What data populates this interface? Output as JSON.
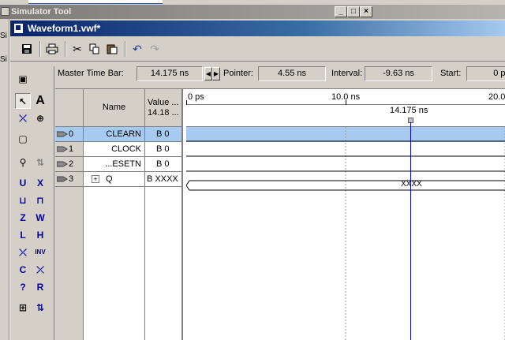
{
  "outer_window": {
    "title": "Simulator Tool",
    "controls": {
      "minimize": "_",
      "maximize": "□",
      "close": "×"
    },
    "side_text": [
      "Si",
      "Si"
    ]
  },
  "inner_window": {
    "title": "Waveform1.vwf*"
  },
  "toolbar": {
    "save_icon": "save-icon",
    "print_icon": "print-icon",
    "cut_icon": "scissors-icon",
    "copy_icon": "copy-icon",
    "paste_icon": "paste-icon",
    "undo_icon": "undo-icon",
    "redo_icon": "redo-icon"
  },
  "timebar": {
    "master_label": "Master Time Bar:",
    "master_value": "14.175 ns",
    "pointer_label": "Pointer:",
    "pointer_value": "4.55 ns",
    "interval_label": "Interval:",
    "interval_value": "-9.63 ns",
    "start_label": "Start:",
    "start_value": "0 ps"
  },
  "grid": {
    "name_header": "Name",
    "value_header_line1": "Value ...",
    "value_header_line2": "14.18 ...",
    "ruler": {
      "tick0": "0 ps",
      "tick1": "10.0 ns",
      "tick2": "20.0",
      "master_marker": "14.175 ns"
    },
    "rows": [
      {
        "index": "0",
        "name": "CLEARN",
        "value": "B 0",
        "type": "input",
        "selected": true,
        "expandable": false
      },
      {
        "index": "1",
        "name": "CLOCK",
        "value": "B 0",
        "type": "input",
        "selected": false,
        "expandable": false
      },
      {
        "index": "2",
        "name": "...ESETN",
        "value": "B 0",
        "type": "input",
        "selected": false,
        "expandable": false
      },
      {
        "index": "3",
        "name": "Q",
        "value": "B XXXX",
        "type": "output",
        "selected": false,
        "expandable": true,
        "expander": "+",
        "bus_label": "XXXX"
      }
    ]
  },
  "palette": {
    "tools": [
      "pointer-icon",
      "text-icon",
      "waveform-edit-icon",
      "zoom-icon",
      "fullscreen-icon",
      "find-icon",
      "replace-icon",
      "uninitialized-icon",
      "forcing-unknown-icon",
      "forcing-low-icon",
      "forcing-high-icon",
      "high-impedance-icon",
      "weak-unknown-icon",
      "weak-low-icon",
      "weak-high-icon",
      "invert-icon",
      "count-value-icon",
      "clock-value-icon",
      "arbitrary-value-icon",
      "random-value-icon",
      "dont-care-icon",
      "snap-grid-icon",
      "sort-icon"
    ],
    "labels": {
      "u": "U",
      "x": "X",
      "z": "Z",
      "w": "W",
      "l": "L",
      "h": "H",
      "inv": "INV",
      "c": "C",
      "q": "?",
      "r": "R"
    }
  },
  "colors": {
    "selection": "#a6caf0",
    "time_bar": "#0000c0",
    "active_title": "#0a246a",
    "inactive_title": "#808080"
  }
}
